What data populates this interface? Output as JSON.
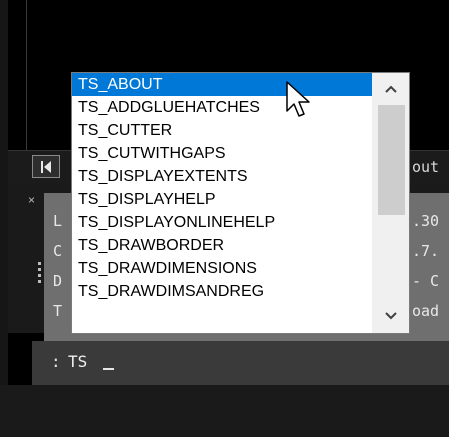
{
  "tab_strip": {
    "first_icon": "first-page-icon",
    "partial_tab_label": "out"
  },
  "history": {
    "close_glyph": "×",
    "lines": [
      {
        "left": "L",
        "right": ".30"
      },
      {
        "left": "C",
        "right": ".7."
      },
      {
        "left": "D",
        "right": "- C"
      },
      {
        "left": "T",
        "right": "oad"
      }
    ]
  },
  "command_line": {
    "prompt": ":",
    "input": "TS"
  },
  "autocomplete": {
    "selected_index": 0,
    "items": [
      "TS_ABOUT",
      "TS_ADDGLUEHATCHES",
      "TS_CUTTER",
      "TS_CUTWITHGAPS",
      "TS_DISPLAYEXTENTS",
      "TS_DISPLAYHELP",
      "TS_DISPLAYONLINEHELP",
      "TS_DRAWBORDER",
      "TS_DRAWDIMENSIONS",
      "TS_DRAWDIMSANDREG"
    ],
    "scroll_up_icon": "chevron-up-icon",
    "scroll_down_icon": "chevron-down-icon",
    "colors": {
      "selection": "#0078d7",
      "background": "#ffffff"
    }
  }
}
